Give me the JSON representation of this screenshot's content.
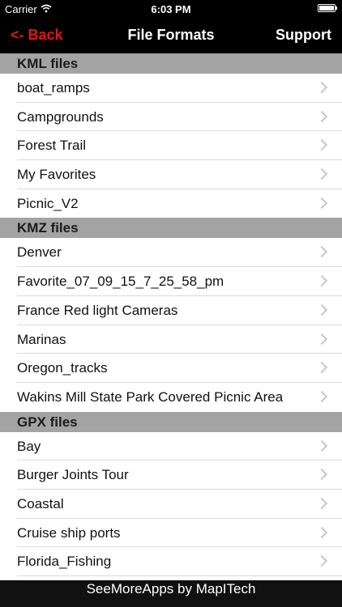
{
  "status_bar": {
    "carrier": "Carrier",
    "time": "6:03 PM"
  },
  "nav": {
    "back_label": "<- Back",
    "title": "File Formats",
    "support_label": "Support"
  },
  "sections": [
    {
      "header": "KML files",
      "items": [
        "boat_ramps",
        "Campgrounds",
        "Forest Trail",
        "My Favorites",
        "Picnic_V2"
      ]
    },
    {
      "header": "KMZ files",
      "items": [
        "Denver",
        "Favorite_07_09_15_7_25_58_pm",
        "France Red light Cameras",
        "Marinas",
        "Oregon_tracks",
        "Wakins Mill State Park Covered Picnic Area"
      ]
    },
    {
      "header": "GPX files",
      "items": [
        "Bay",
        "Burger Joints Tour",
        "Coastal",
        "Cruise ship ports",
        "Florida_Fishing"
      ]
    }
  ],
  "footer": {
    "text": "SeeMoreApps by MapITech"
  }
}
